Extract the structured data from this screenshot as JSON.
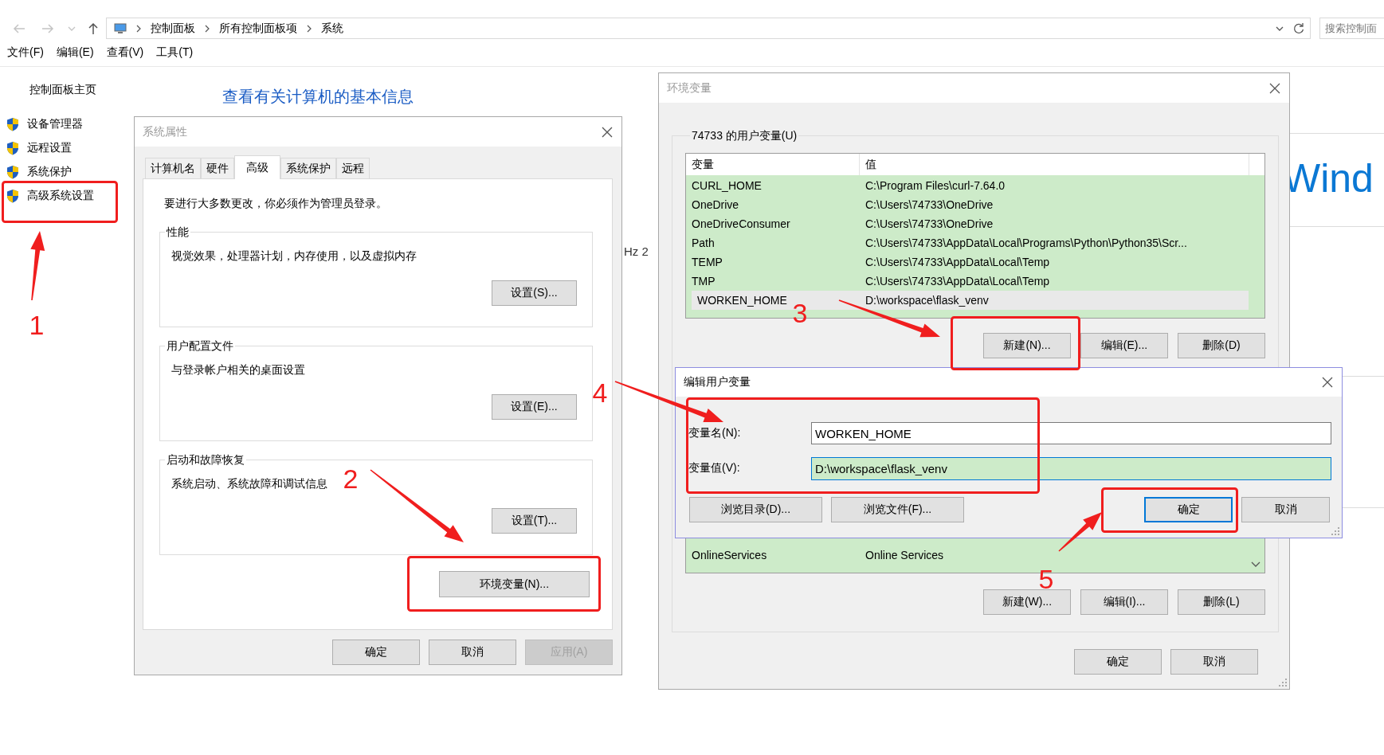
{
  "explorer": {
    "breadcrumbs": [
      "控制面板",
      "所有控制面板项",
      "系统"
    ],
    "search": {
      "placeholder": "搜索控制面"
    },
    "menu": [
      "文件(F)",
      "编辑(E)",
      "查看(V)",
      "工具(T)"
    ],
    "sidebar": {
      "home": "控制面板主页",
      "items": [
        "设备管理器",
        "远程设置",
        "系统保护",
        "高级系统设置"
      ]
    },
    "heading": "查看有关计算机的基本信息",
    "hidden_texts": [
      "Hz  2",
      "Wind"
    ]
  },
  "system_properties": {
    "title": "系统属性",
    "tabs": [
      {
        "label": "计算机名",
        "selected": false
      },
      {
        "label": "硬件",
        "selected": false
      },
      {
        "label": "高级",
        "selected": true
      },
      {
        "label": "系统保护",
        "selected": false
      },
      {
        "label": "远程",
        "selected": false
      }
    ],
    "notice": "要进行大多数更改，你必须作为管理员登录。",
    "groups": [
      {
        "title": "性能",
        "description": "视觉效果，处理器计划，内存使用，以及虚拟内存",
        "button": "设置(S)..."
      },
      {
        "title": "用户配置文件",
        "description": "与登录帐户相关的桌面设置",
        "button": "设置(E)..."
      },
      {
        "title": "启动和故障恢复",
        "description": "系统启动、系统故障和调试信息",
        "button": "设置(T)..."
      }
    ],
    "env_button": "环境变量(N)...",
    "buttons": [
      {
        "label": "确定",
        "disabled": false
      },
      {
        "label": "取消",
        "disabled": false
      },
      {
        "label": "应用(A)",
        "disabled": true
      }
    ]
  },
  "environment_variables": {
    "title": "环境变量",
    "user_group": "74733 的用户变量(U)",
    "columns": [
      "变量",
      "值"
    ],
    "user_rows": [
      {
        "name": "CURL_HOME",
        "value": "C:\\Program Files\\curl-7.64.0",
        "selected": false
      },
      {
        "name": "OneDrive",
        "value": "C:\\Users\\74733\\OneDrive",
        "selected": false
      },
      {
        "name": "OneDriveConsumer",
        "value": "C:\\Users\\74733\\OneDrive",
        "selected": false
      },
      {
        "name": "Path",
        "value": "C:\\Users\\74733\\AppData\\Local\\Programs\\Python\\Python35\\Scr...",
        "selected": false
      },
      {
        "name": "TEMP",
        "value": "C:\\Users\\74733\\AppData\\Local\\Temp",
        "selected": false
      },
      {
        "name": "TMP",
        "value": "C:\\Users\\74733\\AppData\\Local\\Temp",
        "selected": false
      },
      {
        "name": "WORKEN_HOME",
        "value": "D:\\workspace\\flask_venv",
        "selected": true
      }
    ],
    "user_buttons": [
      "新建(N)...",
      "编辑(E)...",
      "删除(D)"
    ],
    "system_rows": [
      {
        "name": "OnlineServices",
        "value": "Online Services"
      }
    ],
    "system_buttons": [
      "新建(W)...",
      "编辑(I)...",
      "删除(L)"
    ],
    "buttons": [
      "确定",
      "取消"
    ]
  },
  "edit_dialog": {
    "title": "编辑用户变量",
    "fields": [
      {
        "label": "变量名(N):",
        "value": "WORKEN_HOME",
        "focused": false
      },
      {
        "label": "变量值(V):",
        "value": "D:\\workspace\\flask_venv",
        "focused": true
      }
    ],
    "browse_buttons": [
      "浏览目录(D)...",
      "浏览文件(F)..."
    ],
    "buttons": [
      {
        "label": "确定",
        "default": true
      },
      {
        "label": "取消",
        "default": false
      }
    ]
  },
  "annotations": [
    {
      "number": "1"
    },
    {
      "number": "2"
    },
    {
      "number": "3"
    },
    {
      "number": "4"
    },
    {
      "number": "5"
    }
  ]
}
